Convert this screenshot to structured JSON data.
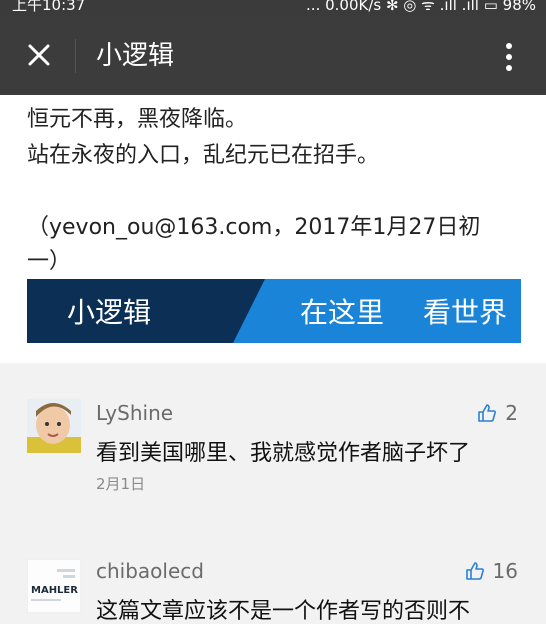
{
  "status_bar": {
    "time": "上午10:37",
    "right": "... 0.00K/s ✻ ◎ ᯤ .ıll .ıll ▭ 98%"
  },
  "navbar": {
    "title": "小逻辑"
  },
  "article": {
    "lines": [
      "恒元不再，黑夜降临。",
      "站在永夜的入口，乱纪元已在招手。",
      "（yevon_ou@163.com，2017年1月27日初",
      "一）"
    ],
    "banner": {
      "brand": "小逻辑",
      "slogan_1": "在这里",
      "slogan_2": "看世界"
    }
  },
  "comments": [
    {
      "name": "LyShine",
      "text": "看到美国哪里、我就感觉作者脑子坏了",
      "date": "2月1日",
      "likes": "2"
    },
    {
      "name": "chibaolecd",
      "text": "这篇文章应该不是一个作者写的否则不",
      "likes": "16",
      "avatar_label": "MAHLER"
    }
  ],
  "colors": {
    "navbar_bg": "#3c3c3c",
    "banner_dark": "#0c2f55",
    "banner_blue": "#1a84d8",
    "comments_bg": "#f2f2f2"
  }
}
